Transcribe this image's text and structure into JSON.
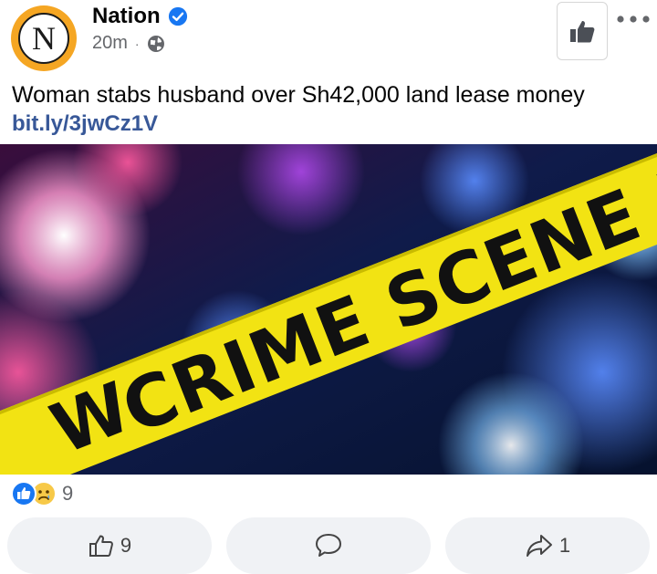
{
  "post": {
    "page_name": "Nation",
    "logo_letter": "N",
    "time": "20m",
    "separator": "·",
    "audience_icon": "globe-icon",
    "verified_icon": "verified-badge-icon",
    "text": "Woman stabs husband over Sh42,000 land lease money",
    "link": "bit.ly/3jwCz1V",
    "image_caption_tape": "CRIME SCENE DO",
    "image_caption_left": "W"
  },
  "reactions": {
    "count": "9",
    "types": [
      "like-reaction-icon",
      "sad-reaction-icon"
    ]
  },
  "actions": {
    "like_count": "9",
    "comment_count": "",
    "share_count": "1"
  },
  "colors": {
    "accent": "#1877f2",
    "link": "#385898",
    "logo_ring": "#f5a623",
    "tape": "#f2e313",
    "button_bg": "#f0f2f5"
  }
}
